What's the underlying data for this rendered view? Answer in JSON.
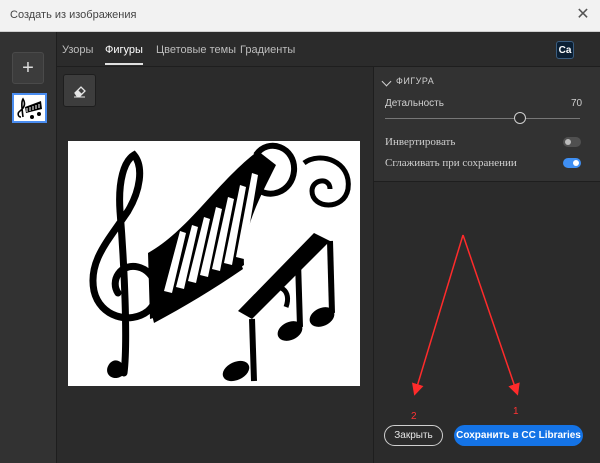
{
  "window": {
    "title": "Создать из изображения",
    "close_glyph": "✕"
  },
  "sidebar": {
    "add_glyph": "+",
    "add_icon": "plus-icon",
    "thumbnail_icon": "music-image-thumbnail"
  },
  "tabs": [
    {
      "label": "Узоры",
      "active": false
    },
    {
      "label": "Фигуры",
      "active": true
    },
    {
      "label": "Цветовые темы",
      "active": false
    },
    {
      "label": "Градиенты",
      "active": false
    }
  ],
  "app_badge": "Ca",
  "toolbar": {
    "eraser_icon": "eraser-icon"
  },
  "panel": {
    "section_title": "ФИГУРА",
    "detail_label": "Детальность",
    "detail_value": "70",
    "invert_label": "Инвертировать",
    "invert_on": false,
    "smooth_label": "Сглаживать при сохранении",
    "smooth_on": true
  },
  "buttons": {
    "close_label": "Закрыть",
    "save_label": "Сохранить в CC Libraries"
  },
  "annotations": {
    "marker_1": "1",
    "marker_2": "2",
    "color": "#ff2b2b"
  },
  "colors": {
    "accent": "#1473e6",
    "toggle_on": "#3f8ff3"
  }
}
